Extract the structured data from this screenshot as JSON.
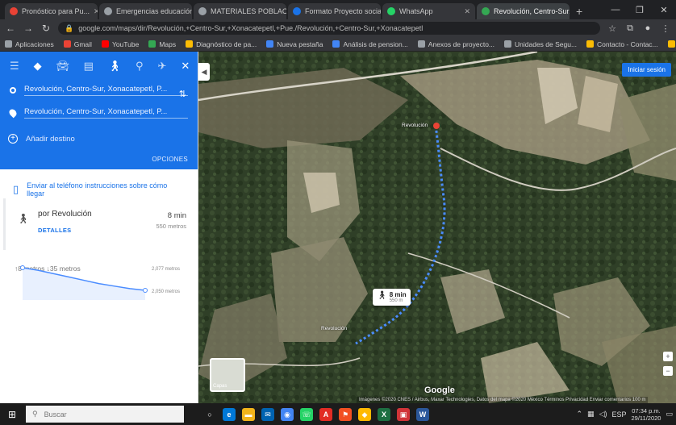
{
  "browser": {
    "tabs": [
      {
        "title": "Pronóstico para Pu...",
        "color": "#e94235"
      },
      {
        "title": "Emergencias educación...",
        "color": "#9aa0a6"
      },
      {
        "title": "MATERIALES POBLACIÓN...",
        "color": "#9aa0a6"
      },
      {
        "title": "Formato Proyecto social de...",
        "color": "#1a73e8"
      },
      {
        "title": "WhatsApp",
        "color": "#25d366"
      },
      {
        "title": "Revolución, Centro-Sur, X...",
        "color": "#34a853",
        "active": true
      }
    ],
    "newtab": "+",
    "window_controls": [
      "—",
      "❐",
      "✕"
    ],
    "url": "google.com/maps/dir/Revolución,+Centro-Sur,+Xonacatepetl,+Pue./Revolución,+Centro-Sur,+Xonacatepetl",
    "bookmarks": [
      {
        "label": "Aplicaciones",
        "color": "#9aa0a6"
      },
      {
        "label": "Gmail",
        "color": "#ea4335"
      },
      {
        "label": "YouTube",
        "color": "#ff0000"
      },
      {
        "label": "Maps",
        "color": "#34a853"
      },
      {
        "label": "Diagnóstico de pa...",
        "color": "#fbbc04"
      },
      {
        "label": "Nueva pestaña",
        "color": "#4285f4"
      },
      {
        "label": "Análisis de pension...",
        "color": "#4285f4"
      },
      {
        "label": "Anexos de proyecto...",
        "color": "#9aa0a6"
      },
      {
        "label": "Unidades de Segu...",
        "color": "#9aa0a6"
      },
      {
        "label": "Contacto - Contac...",
        "color": "#fbbc04"
      },
      {
        "label": "Contacto - Contac...",
        "color": "#fbbc04"
      }
    ]
  },
  "directions": {
    "origin": "Revolución, Centro-Sur, Xonacatepetl, P...",
    "destination": "Revolución, Centro-Sur, Xonacatepetl, P...",
    "add_destination": "Añadir destino",
    "options": "OPCIONES",
    "send_phone": "Enviar al teléfono instrucciones sobre cómo llegar",
    "route_name": "por Revolución",
    "route_time": "8 min",
    "route_dist": "550 metros",
    "details": "DETALLES",
    "elevation_title": "↑8 metros  ↓35 metros",
    "elevation_start": "2,077 metros",
    "elevation_end": "2,050 metros"
  },
  "elevation_chart": {
    "type": "line",
    "values": [
      2077,
      2074,
      2070,
      2066,
      2062,
      2058,
      2055,
      2052,
      2050
    ]
  },
  "map": {
    "signin": "Iniciar sesión",
    "collapse": "◀",
    "bubble_time": "8 min",
    "bubble_dist": "550 m",
    "google": "Google",
    "attribution": "Imágenes ©2020 CNES / Airbus, Maxar Technologies, Datos del mapa ©2020  México  Términos  Privacidad  Enviar comentarios  100 m",
    "layers_label": "Capas",
    "place_labels": [
      "Revolución",
      "Revolución"
    ],
    "zoom": [
      "+",
      "−"
    ]
  },
  "taskbar": {
    "search_placeholder": "Buscar",
    "time": "07:34 p.m.",
    "date": "29/11/2020",
    "lang": "ESP",
    "apps": [
      {
        "name": "task-view",
        "glyph": "○",
        "color": "#1c1c1c"
      },
      {
        "name": "edge",
        "glyph": "e",
        "color": "#0078d7"
      },
      {
        "name": "explorer",
        "glyph": "▬",
        "color": "#f2b41b"
      },
      {
        "name": "mail",
        "glyph": "✉",
        "color": "#0063b1"
      },
      {
        "name": "chrome",
        "glyph": "◉",
        "color": "#4285f4"
      },
      {
        "name": "whatsapp",
        "glyph": "☏",
        "color": "#25d366"
      },
      {
        "name": "acrobat",
        "glyph": "A",
        "color": "#e22c24"
      },
      {
        "name": "app-orange",
        "glyph": "⚑",
        "color": "#f25022"
      },
      {
        "name": "app-yellow",
        "glyph": "◆",
        "color": "#ffb900"
      },
      {
        "name": "excel",
        "glyph": "X",
        "color": "#1d6f42"
      },
      {
        "name": "app-red",
        "glyph": "▣",
        "color": "#d13438"
      },
      {
        "name": "word",
        "glyph": "W",
        "color": "#2b579a"
      }
    ]
  }
}
